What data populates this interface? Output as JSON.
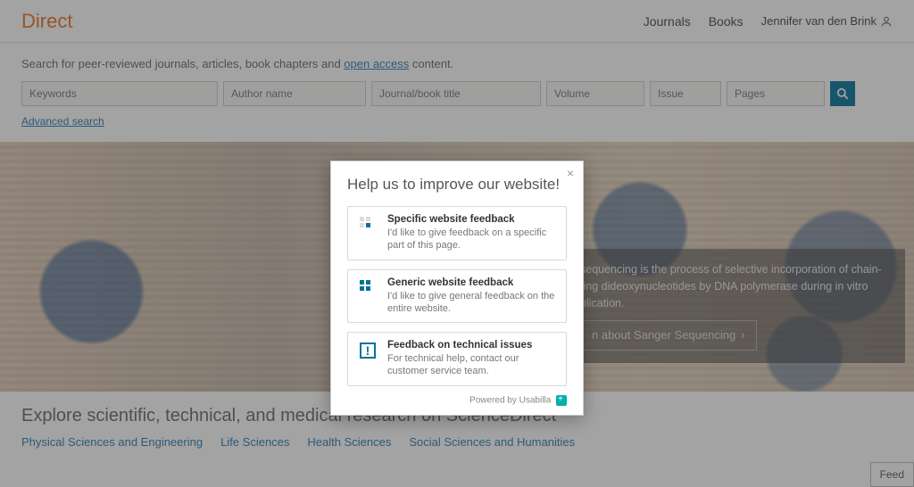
{
  "brand": "Direct",
  "nav": {
    "journals": "Journals",
    "books": "Books"
  },
  "user": {
    "name": "Jennifer van den Brink"
  },
  "search": {
    "intro_prefix": "Search for peer-reviewed journals, articles, book chapters and ",
    "open_access": "open access",
    "intro_suffix": " content.",
    "placeholders": {
      "keywords": "Keywords",
      "author": "Author name",
      "title": "Journal/book title",
      "volume": "Volume",
      "issue": "Issue",
      "pages": "Pages"
    },
    "advanced": "Advanced search"
  },
  "hero": {
    "text": "sequencing is the process of selective incorporation of chain-ting dideoxynucleotides by DNA polymerase during in vitro plication.",
    "button": "n about Sanger Sequencing"
  },
  "explore": {
    "title": "Explore scientific, technical, and medical research on ScienceDirect",
    "tabs": [
      "Physical Sciences and Engineering",
      "Life Sciences",
      "Health Sciences",
      "Social Sciences and Humanities"
    ]
  },
  "feedback_tab": "Feed",
  "modal": {
    "title": "Help us to improve our website!",
    "options": [
      {
        "title": "Specific website feedback",
        "desc": "I'd like to give feedback on a specific part of this page."
      },
      {
        "title": "Generic website feedback",
        "desc": "I'd like to give general feedback on the entire website."
      },
      {
        "title": "Feedback on technical issues",
        "desc": "For technical help, contact our customer service team."
      }
    ],
    "powered": "Powered by Usabilla"
  }
}
